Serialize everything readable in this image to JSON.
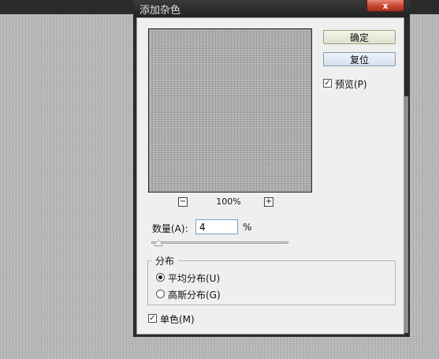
{
  "dialog": {
    "title": "添加杂色",
    "close_label": "x",
    "ok_label": "确定",
    "reset_label": "复位",
    "preview_label": "预览(P)",
    "preview_checked": true,
    "zoom_out_label": "−",
    "zoom_in_label": "+",
    "zoom_level": "100%",
    "amount_label": "数量(A):",
    "amount_value": "4",
    "amount_unit": "%",
    "amount_slider_fraction": 0.04,
    "distribution": {
      "title": "分布",
      "options": [
        {
          "label": "平均分布(U)",
          "selected": true
        },
        {
          "label": "高斯分布(G)",
          "selected": false
        }
      ]
    },
    "monochrome_label": "单色(M)",
    "monochrome_checked": true
  },
  "colors": {
    "canvas": "#b8b8b8",
    "close_button": "#c7442f",
    "ok_button": "#dfe0cc",
    "reset_button": "#d6e0f0"
  },
  "icons": {
    "close": "close-icon",
    "checkbox": "checkmark-icon",
    "zoom_out": "minus-icon",
    "zoom_in": "plus-icon"
  }
}
